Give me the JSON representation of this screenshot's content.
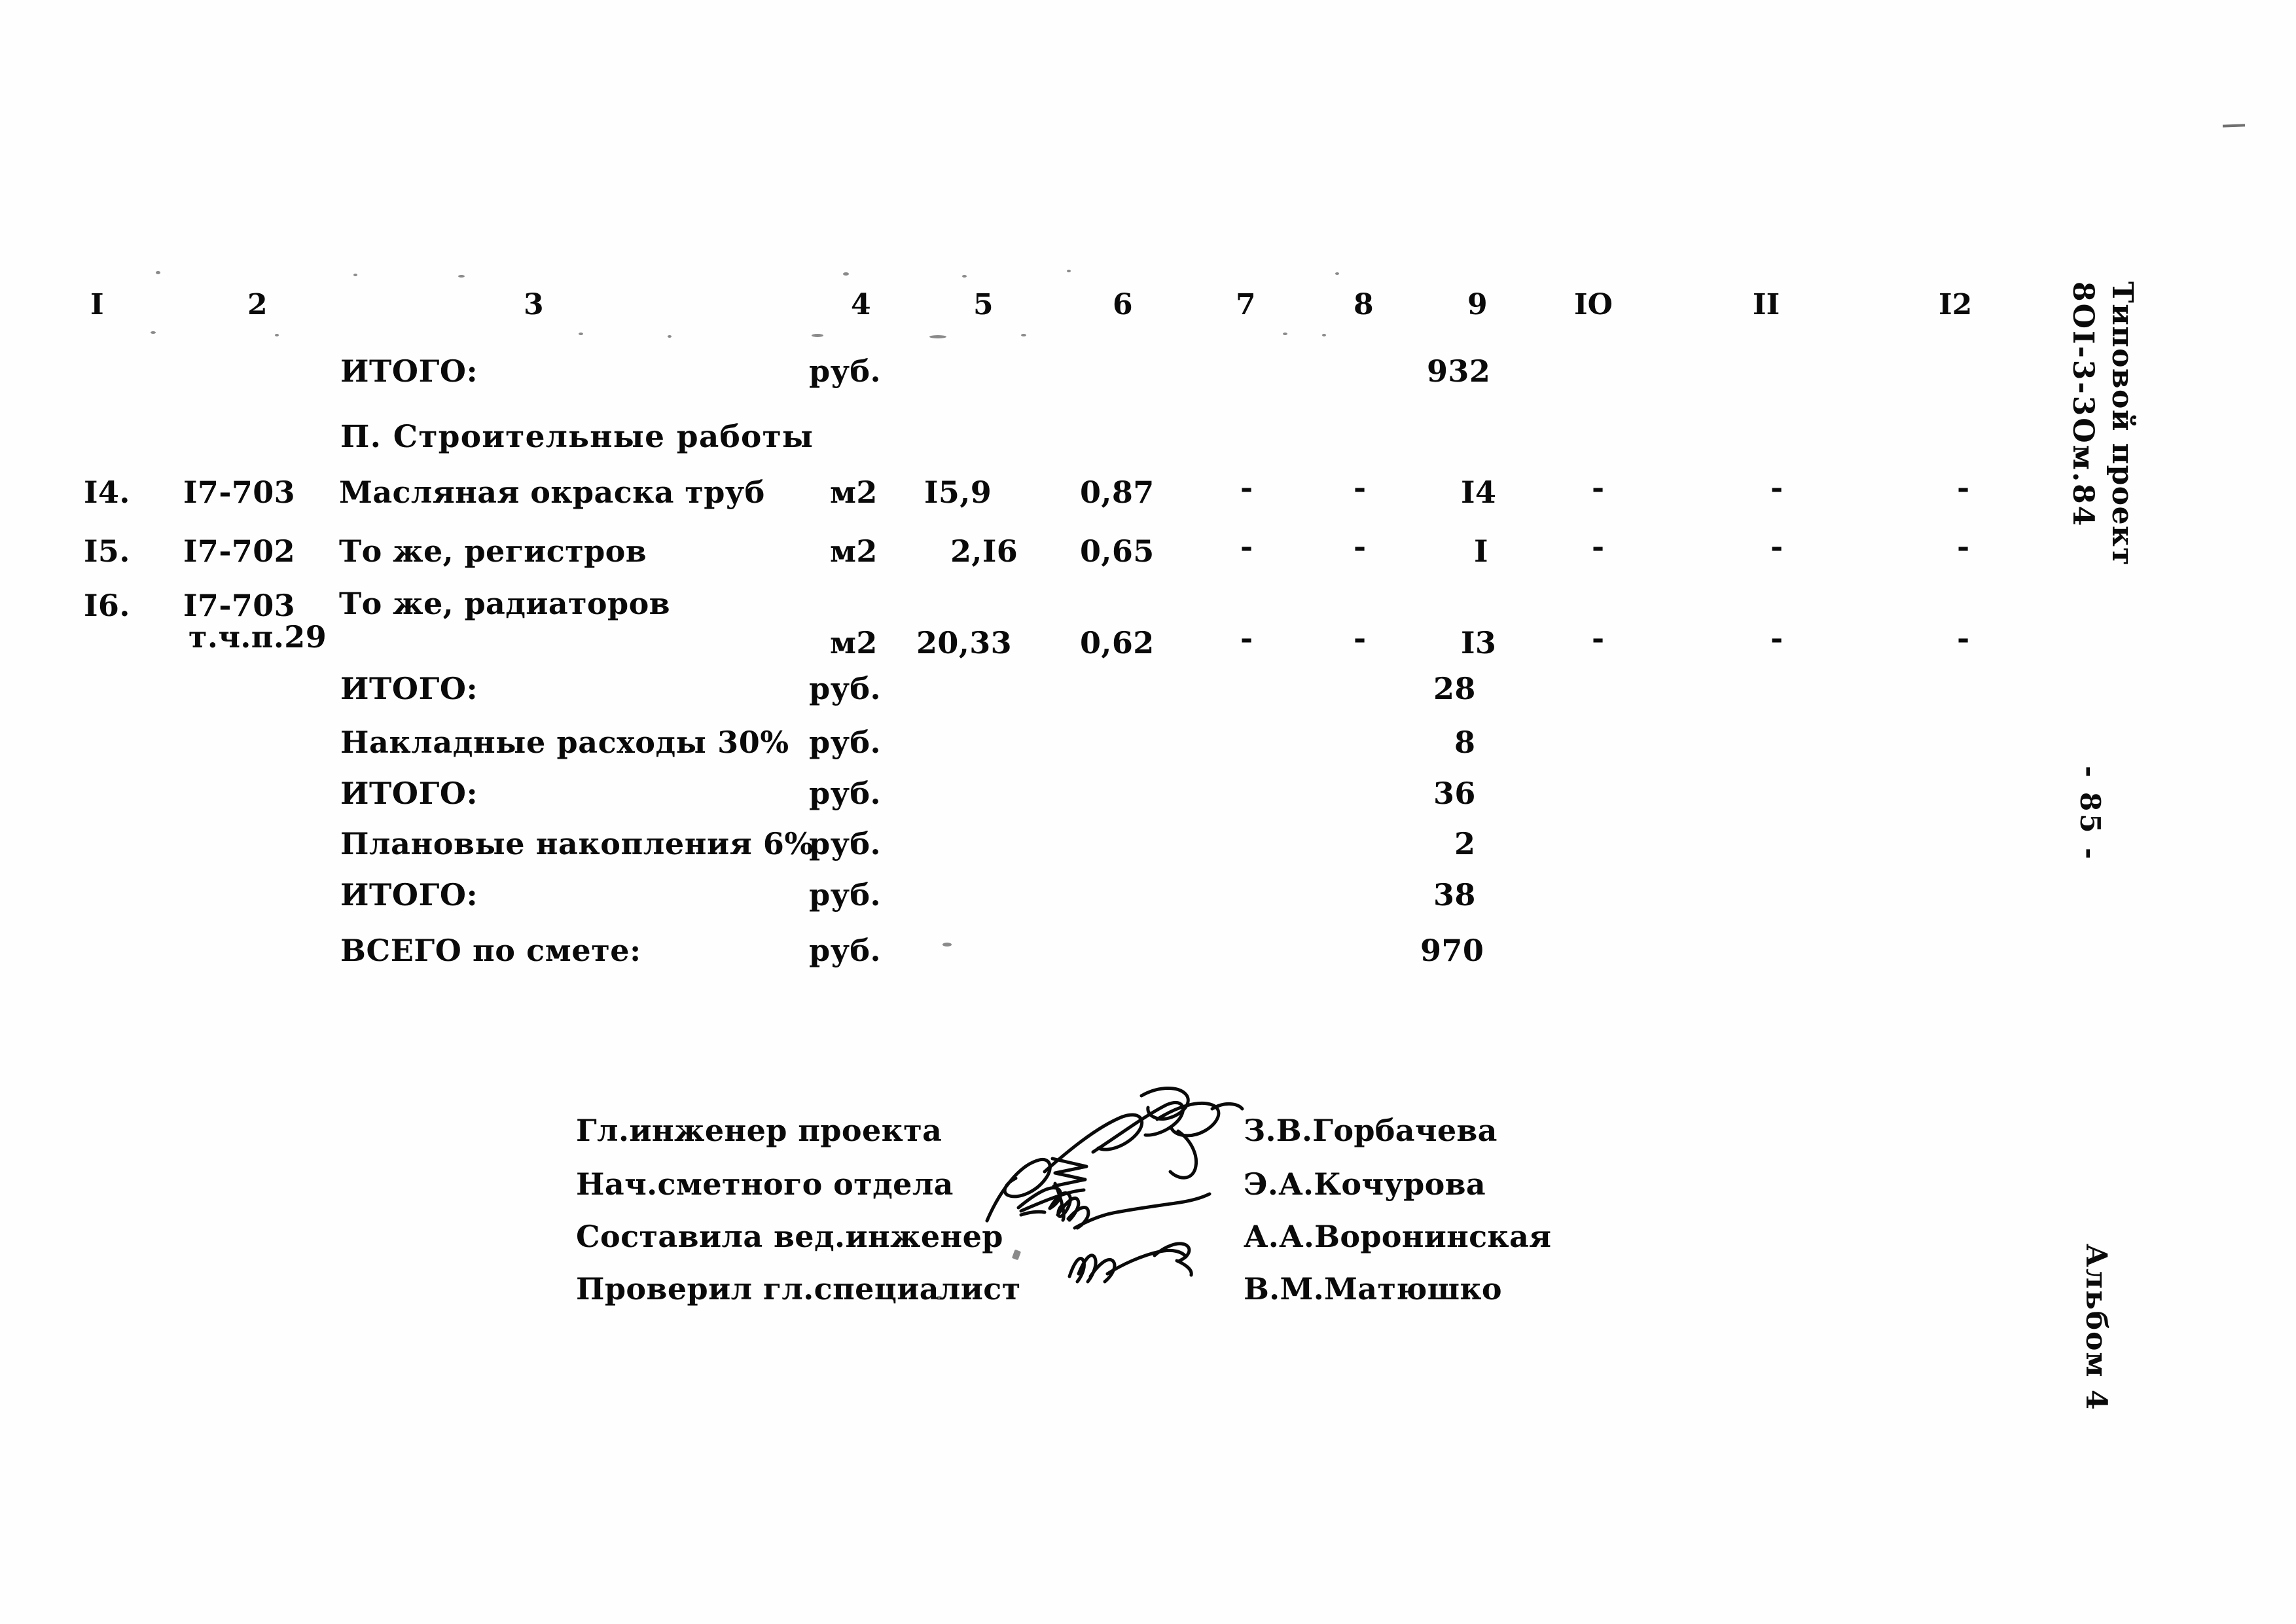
{
  "document": {
    "type": "construction-estimate-sheet",
    "column_headers": [
      "I",
      "2",
      "3",
      "4",
      "5",
      "6",
      "7",
      "8",
      "9",
      "IO",
      "II",
      "I2"
    ],
    "currency_unit": "руб.",
    "measure_unit": "м2",
    "dash": "-"
  },
  "top_total": {
    "label": "ИТОГО:",
    "unit": "руб.",
    "value": "932"
  },
  "section": {
    "heading": "П. Строительные работы"
  },
  "rows": [
    {
      "no": "I4.",
      "code": "I7-703",
      "name": "Масляная окраска труб",
      "note": "",
      "unit": "м2",
      "qty": "I5,9",
      "price": "0,87",
      "c7": "-",
      "c8": "-",
      "c9": "I4",
      "c10": "-",
      "c11": "-",
      "c12": "-"
    },
    {
      "no": "I5.",
      "code": "I7-702",
      "name": "То же, регистров",
      "note": "",
      "unit": "м2",
      "qty": "2,I6",
      "price": "0,65",
      "c7": "-",
      "c8": "-",
      "c9": "I",
      "c10": "-",
      "c11": "-",
      "c12": "-"
    },
    {
      "no": "I6.",
      "code": "I7-703",
      "name": "То же, радиаторов",
      "note": "т.ч.п.29",
      "unit": "м2",
      "qty": "20,33",
      "price": "0,62",
      "c7": "-",
      "c8": "-",
      "c9": "I3",
      "c10": "-",
      "c11": "-",
      "c12": "-"
    }
  ],
  "summary": [
    {
      "label": "ИТОГО:",
      "unit": "руб.",
      "value": "28"
    },
    {
      "label": "Накладные расходы 30%",
      "unit": "руб.",
      "value": "8"
    },
    {
      "label": "ИТОГО:",
      "unit": "руб.",
      "value": "36"
    },
    {
      "label": "Плановые накопления 6%",
      "unit": "руб.",
      "value": "2"
    },
    {
      "label": "ИТОГО:",
      "unit": "руб.",
      "value": "38"
    }
  ],
  "grand_total": {
    "label": "ВСЕГО по смете:",
    "unit": "руб.",
    "value": "970"
  },
  "signatures": [
    {
      "role": "Гл.инженер проекта",
      "name": "З.В.Горбачева"
    },
    {
      "role": "Нач.сметного отдела",
      "name": "Э.А.Кочурова"
    },
    {
      "role": "Составила вед.инженер",
      "name": "А.А.Воронинская"
    },
    {
      "role": "Проверил гл.специалист",
      "name": "В.М.Матюшко"
    }
  ],
  "margin": {
    "project_label": "Типовой проект",
    "project_code": "8OI-3-3Oм.84",
    "page_number": "- 85 -",
    "album": "Альбом 4"
  }
}
